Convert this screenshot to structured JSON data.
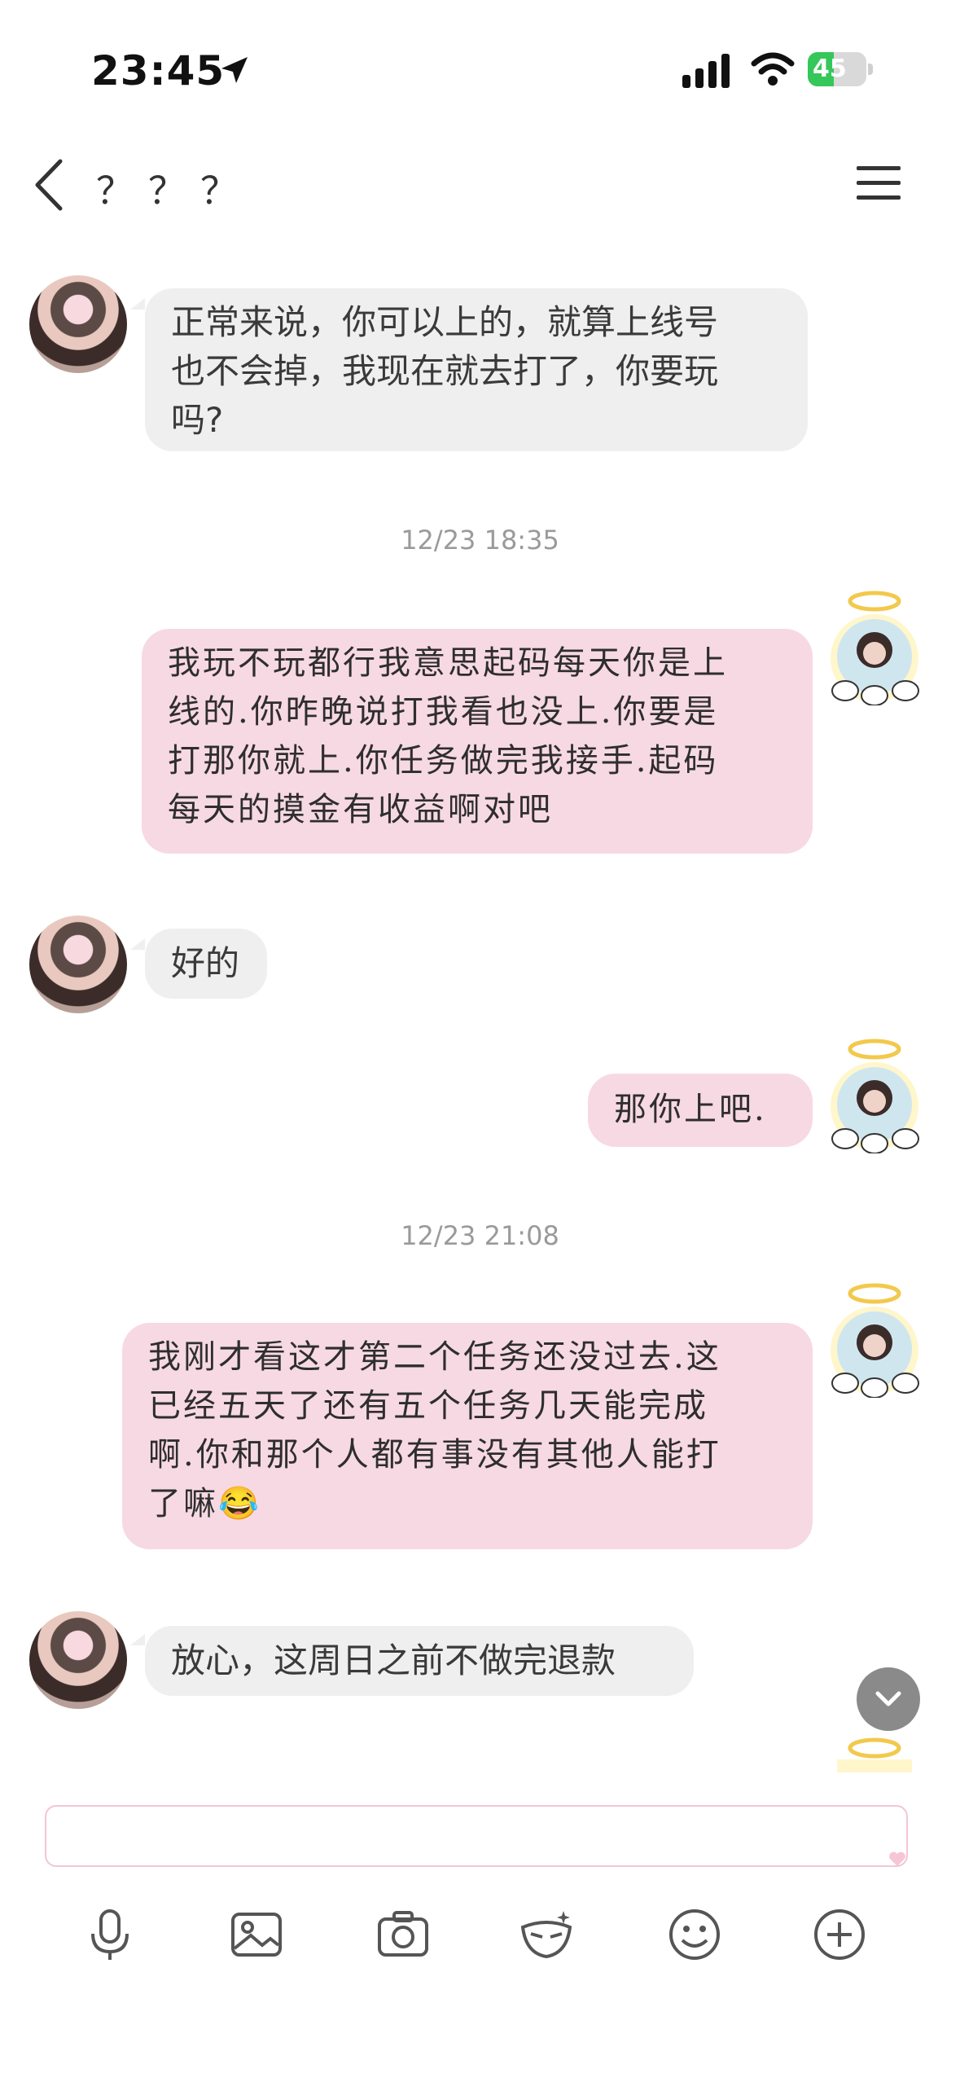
{
  "status_bar": {
    "time": "23:45",
    "battery": "45",
    "battery_level": 0.45
  },
  "nav": {
    "title": "？？？"
  },
  "messages": [
    {
      "side": "left",
      "text_lines": [
        "正常来说，你可以上的，就算上线号",
        "也不会掉，我现在就去打了，你要玩",
        "吗?"
      ]
    },
    {
      "timestamp": "12/23 18:35"
    },
    {
      "side": "right",
      "text_lines": [
        "我玩不玩都行我意思起码每天你是上",
        "线的.你昨晚说打我看也没上.你要是",
        "打那你就上.你任务做完我接手.起码",
        "每天的摸金有收益啊对吧"
      ]
    },
    {
      "side": "left",
      "text_lines": [
        "好的"
      ]
    },
    {
      "side": "right",
      "text_lines": [
        "那你上吧."
      ]
    },
    {
      "timestamp": "12/23 21:08"
    },
    {
      "side": "right",
      "text_lines": [
        "我刚才看这才第二个任务还没过去.这",
        "已经五天了还有五个任务几天能完成",
        "啊.你和那个人都有事没有其他人能打",
        "了嘛"
      ],
      "emoji": "😂"
    },
    {
      "side": "left",
      "text_lines": [
        "放心，这周日之前不做完退款"
      ]
    }
  ],
  "input": {
    "placeholder": ""
  },
  "toolbar": [
    "mic-icon",
    "image-icon",
    "camera-icon",
    "mask-icon",
    "emoji-icon",
    "plus-icon"
  ]
}
